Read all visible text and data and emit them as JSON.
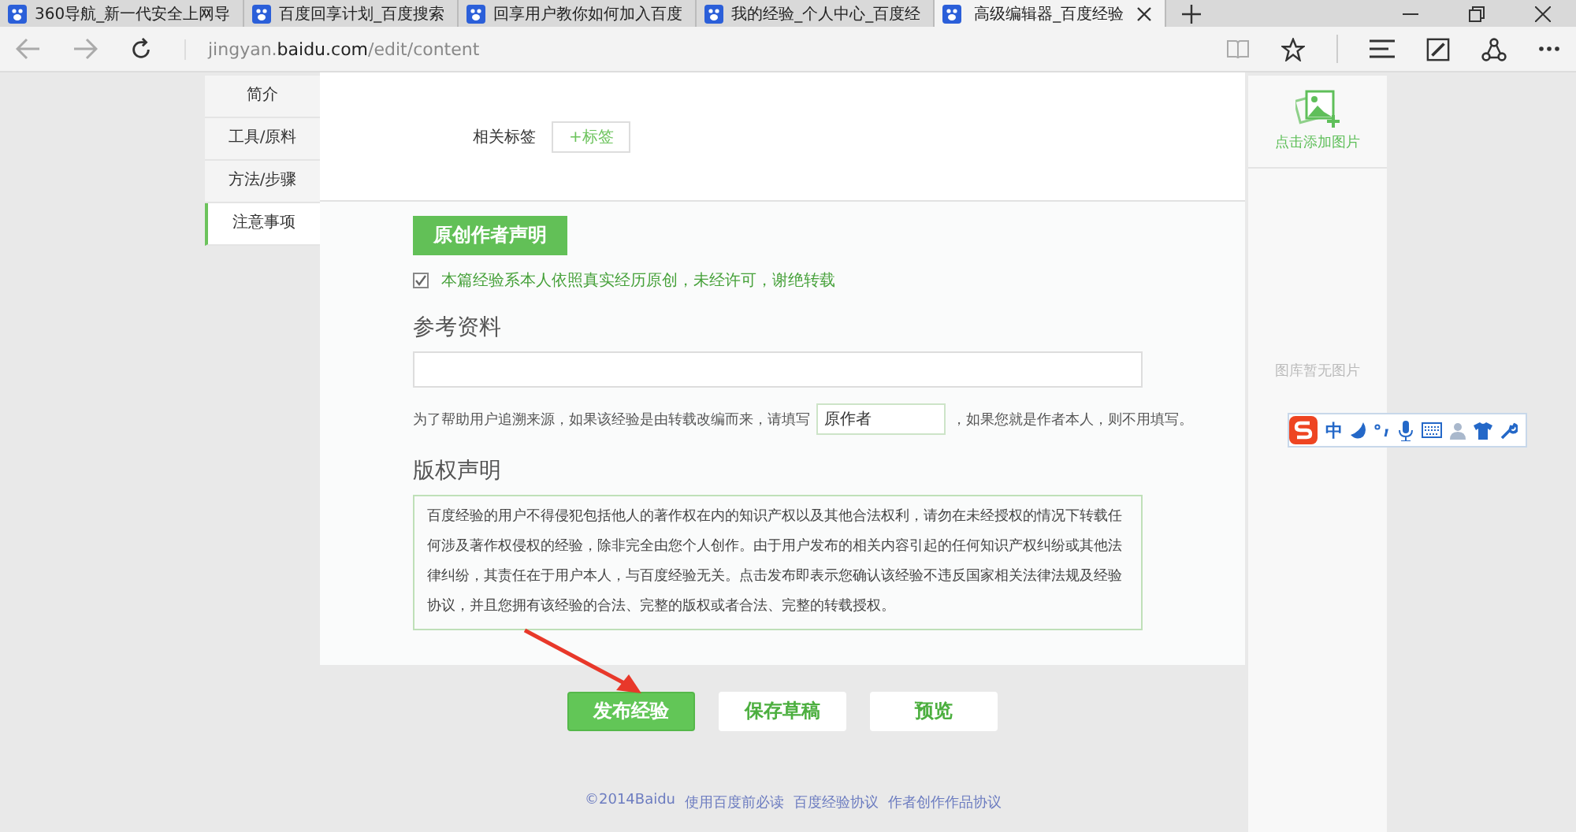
{
  "browser": {
    "tabs": [
      {
        "title": "360导航_新一代安全上网导",
        "selected": false
      },
      {
        "title": "百度回享计划_百度搜索",
        "selected": false
      },
      {
        "title": "回享用户教你如何加入百度",
        "selected": false
      },
      {
        "title": "我的经验_个人中心_百度经",
        "selected": false
      },
      {
        "title": "高级编辑器_百度经验",
        "selected": true
      }
    ],
    "address": "jingyan.**baidu.com**/edit/content"
  },
  "nav": [
    {
      "label": "简介",
      "selected": false
    },
    {
      "label": "工具/原料",
      "selected": false
    },
    {
      "label": "方法/步骤",
      "selected": false
    },
    {
      "label": "注意事项",
      "selected": true
    }
  ],
  "tags": {
    "label": "相关标签",
    "button": "+标签"
  },
  "original_statement": {
    "heading": "原创作者声明",
    "checkbox": {
      "checked": true,
      "label": "本篇经验系本人依照真实经历原创，未经许可，谢绝转载"
    }
  },
  "references": {
    "heading": "参考资料",
    "hint_before": "为了帮助用户追溯来源，如果该经验是由转载改编而来，请填写",
    "author_field": {
      "placeholder": "原作者"
    },
    "hint_after": "，如果您就是作者本人，则不用填写。"
  },
  "copyright": {
    "heading": "版权声明",
    "text": "百度经验的用户不得侵犯包括他人的著作权在内的知识产权以及其他合法权利，请勿在未经授权的情况下转载任何涉及著作权侵权的经验，除非完全由您个人创作。由于用户发布的相关内容引起的任何知识产权纠纷或其他法律纠纷，其责任在于用户本人，与百度经验无关。点击发布即表示您确认该经验不违反国家相关法律法规及经验协议，并且您拥有该经验的合法、完整的版权或者合法、完整的转载授权。"
  },
  "actions": [
    {
      "label": "发布经验",
      "kind": "primary"
    },
    {
      "label": "保存草稿",
      "kind": "secondary"
    },
    {
      "label": "预览",
      "kind": "secondary"
    }
  ],
  "footer": [
    "©2014Baidu",
    "使用百度前必读",
    "百度经验协议",
    "作者创作作品协议"
  ],
  "image_panel": {
    "add_label": "点击添加图片",
    "empty_text": "图库暂无图片"
  },
  "ime_toolbar": {
    "mode": "中"
  }
}
